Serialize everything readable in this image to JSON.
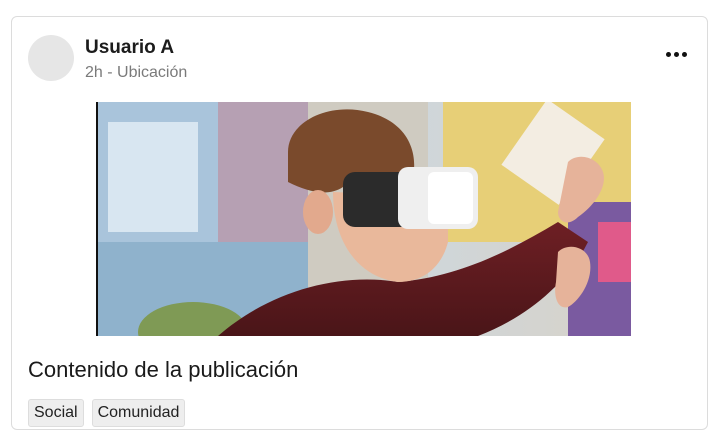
{
  "post": {
    "username": "Usuario A",
    "meta": "2h - Ubicación",
    "image_subject": "person-wearing-vr-headset",
    "content": "Contenido de la publicación",
    "tags": [
      "Social",
      "Comunidad"
    ]
  },
  "icons": {
    "more": "more-horizontal-icon"
  },
  "colors": {
    "card_border": "#dcdcdc",
    "avatar_placeholder": "#e6e6e6",
    "meta_text": "#7a7a7a",
    "tag_bg": "#eeeeee"
  }
}
